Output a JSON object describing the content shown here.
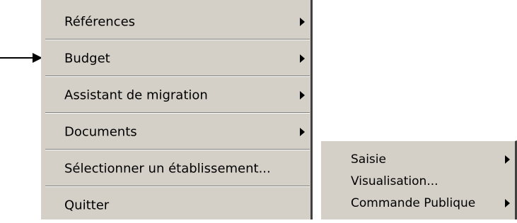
{
  "main_menu": {
    "items": [
      {
        "label": "Références",
        "has_submenu": true
      },
      {
        "label": "Budget",
        "has_submenu": true,
        "pointed": true
      },
      {
        "label": "Assistant de migration",
        "has_submenu": true
      },
      {
        "label": "Documents",
        "has_submenu": true
      },
      {
        "label": "Sélectionner un établissement...",
        "has_submenu": false
      },
      {
        "label": "Quitter",
        "has_submenu": false
      }
    ]
  },
  "sub_menu": {
    "items": [
      {
        "label": "Saisie",
        "has_submenu": true
      },
      {
        "label": "Visualisation...",
        "has_submenu": false
      },
      {
        "label": "Commande Publique",
        "has_submenu": true
      }
    ]
  },
  "colors": {
    "menu_background": "#d4d0c8",
    "menu_shadow": "#404040",
    "separator_dark": "#808080",
    "separator_light": "#ffffff",
    "text": "#000000"
  }
}
